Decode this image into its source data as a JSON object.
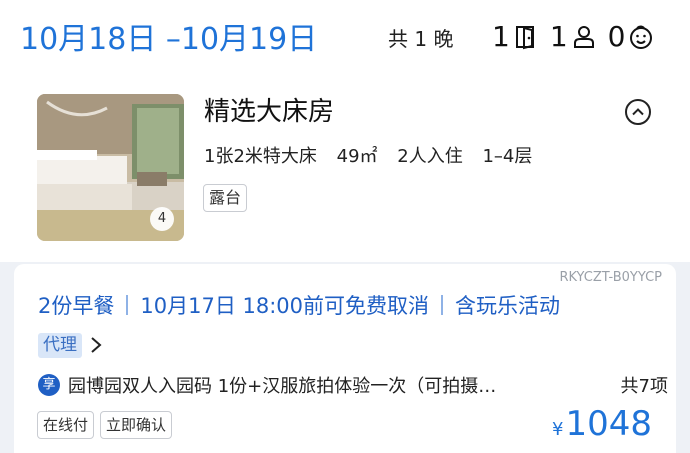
{
  "header": {
    "date_range": "10月18日 –10月19日",
    "nights": "共 1 晚",
    "rooms_count": "1",
    "adults_count": "1",
    "children_count": "0",
    "icons": [
      "door-icon",
      "person-icon",
      "child-icon"
    ]
  },
  "room": {
    "name": "精选大床房",
    "photo_count": "4",
    "specs": [
      "1张2米特大床",
      "49㎡",
      "2人入住",
      "1–4层"
    ],
    "tag": "露台",
    "collapse_icon": "chevron-up-circle-icon"
  },
  "offer": {
    "code": "RKYCZT-B0YYCP",
    "highlights": [
      "2份早餐",
      "10月17日 18:00前可免费取消",
      "含玩乐活动"
    ],
    "agent_badge": "代理",
    "perk_icon_text": "享",
    "perk_text": "园博园双人入园码 1份+汉服旅拍体验一次（可拍摄…",
    "perk_count": "共7项",
    "tags": [
      "在线付",
      "立即确认"
    ],
    "currency": "¥",
    "price": "1048"
  },
  "colors": {
    "accent_blue": "#1f73d8",
    "highlight_blue": "#1f5fc4",
    "page_bg": "#eef1f6"
  }
}
